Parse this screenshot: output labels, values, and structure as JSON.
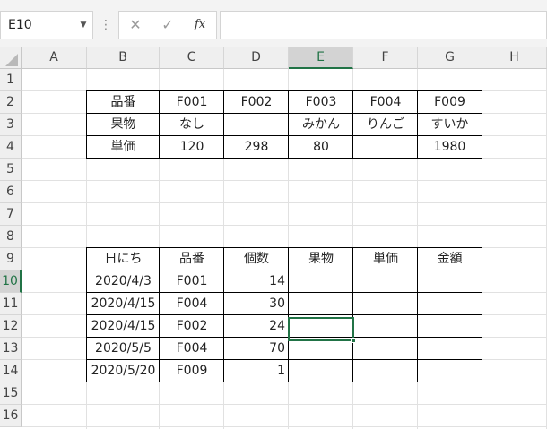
{
  "formula_bar": {
    "name_box": "E10",
    "name_box_arrow": "▼",
    "more_glyph": "⋮",
    "cancel_glyph": "✕",
    "enter_glyph": "✓",
    "fx_label": "fx",
    "formula": ""
  },
  "colors": {
    "accent": "#217346",
    "header_bg": "#efefef",
    "gridline": "#e1e1e1"
  },
  "columns": [
    "A",
    "B",
    "C",
    "D",
    "E",
    "F",
    "G",
    "H"
  ],
  "rows": [
    "1",
    "2",
    "3",
    "4",
    "5",
    "6",
    "7",
    "8",
    "9",
    "10",
    "11",
    "12",
    "13",
    "14",
    "15",
    "16"
  ],
  "selected": {
    "column": "E",
    "row": "10"
  },
  "table1": [
    [
      "品番",
      "F001",
      "F002",
      "F003",
      "F004",
      "F009"
    ],
    [
      "果物",
      "なし",
      "",
      "みかん",
      "りんご",
      "すいか"
    ],
    [
      "単価",
      "120",
      "298",
      "80",
      "",
      "1980"
    ]
  ],
  "table2": {
    "headers": [
      "日にち",
      "品番",
      "個数",
      "果物",
      "単価",
      "金額"
    ],
    "rows": [
      [
        "2020/4/3",
        "F001",
        "14",
        "",
        "",
        ""
      ],
      [
        "2020/4/15",
        "F004",
        "30",
        "",
        "",
        ""
      ],
      [
        "2020/4/15",
        "F002",
        "24",
        "",
        "",
        ""
      ],
      [
        "2020/5/5",
        "F004",
        "70",
        "",
        "",
        ""
      ],
      [
        "2020/5/20",
        "F009",
        "1",
        "",
        "",
        ""
      ]
    ]
  }
}
